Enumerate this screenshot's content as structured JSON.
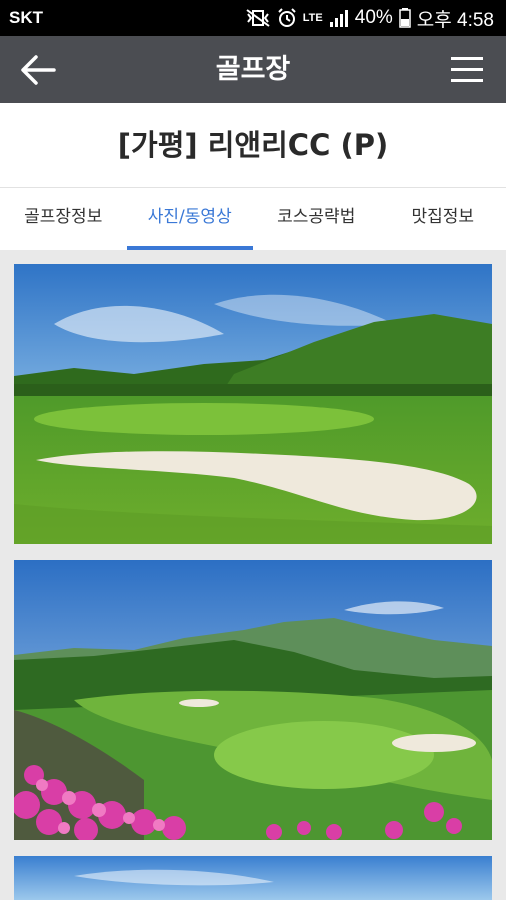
{
  "status_bar": {
    "carrier": "SKT",
    "network": "LTE",
    "battery": "40%",
    "time": "오후 4:58"
  },
  "app_bar": {
    "title": "골프장",
    "back_icon": "arrow-left-icon",
    "menu_icon": "hamburger-menu-icon"
  },
  "course": {
    "name": "[가평] 리앤리CC (P)"
  },
  "tabs": [
    {
      "label": "골프장정보",
      "active": false
    },
    {
      "label": "사진/동영상",
      "active": true
    },
    {
      "label": "코스공략법",
      "active": false
    },
    {
      "label": "맛집정보",
      "active": false
    }
  ],
  "colors": {
    "app_bar": "#4b4d52",
    "accent": "#3a78d6",
    "background": "#e9e9e9"
  }
}
